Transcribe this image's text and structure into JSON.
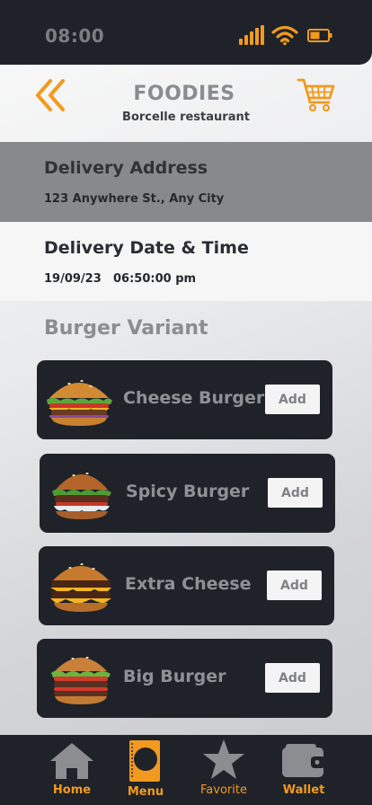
{
  "status_bar": {
    "time": "08:00"
  },
  "header": {
    "title": "FOODIES",
    "subtitle": "Borcelle restaurant"
  },
  "delivery_address": {
    "title": "Delivery Address",
    "value": "123 Anywhere St., Any City"
  },
  "delivery_datetime": {
    "title": "Delivery Date & Time",
    "date": "19/09/23",
    "time": "06:50:00 pm"
  },
  "variants": {
    "heading": "Burger Variant",
    "items": [
      {
        "name": "Cheese Burger",
        "add_label": "Add"
      },
      {
        "name": "Spicy Burger",
        "add_label": "Add"
      },
      {
        "name": "Extra Cheese",
        "add_label": "Add"
      },
      {
        "name": "Big Burger",
        "add_label": "Add"
      }
    ]
  },
  "tabs": [
    {
      "label": "Home",
      "icon": "home-icon"
    },
    {
      "label": "Menu",
      "icon": "menu-icon"
    },
    {
      "label": "Favorite",
      "icon": "star-icon"
    },
    {
      "label": "Wallet",
      "icon": "wallet-icon"
    }
  ],
  "colors": {
    "accent": "#f29a1f",
    "dark": "#1f2329",
    "muted": "#8a8c90"
  }
}
